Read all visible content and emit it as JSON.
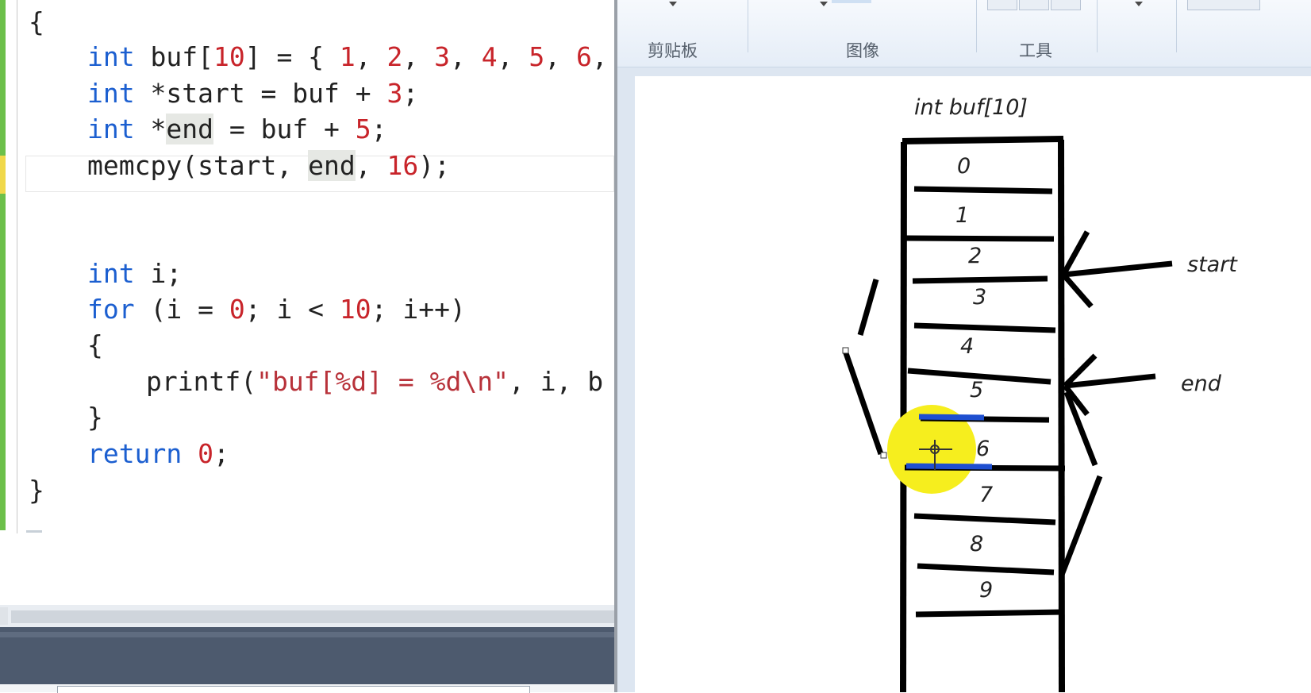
{
  "editor": {
    "lines": {
      "l1": {
        "brace": "{"
      },
      "l2": {
        "kw": "int",
        "a": " buf[",
        "n1": "10",
        "b": "] = { ",
        "v1": "1",
        "c1": ", ",
        "v2": "2",
        "c2": ", ",
        "v3": "3",
        "c3": ", ",
        "v4": "4",
        "c4": ", ",
        "v5": "5",
        "c5": ", ",
        "v6": "6",
        "c6": ","
      },
      "l3": {
        "kw": "int",
        "a": " *start = buf + ",
        "n": "3",
        "b": ";"
      },
      "l4": {
        "kw": "int",
        "a": " *",
        "ref": "end",
        "b": " = buf + ",
        "n": "5",
        "c": ";"
      },
      "l5": {
        "a": "memcpy(start, ",
        "ref": "end",
        "b": ", ",
        "n": "16",
        "c": ");"
      },
      "l6": {
        "kw": "int",
        "a": " i;"
      },
      "l7": {
        "kw": "for",
        "a": " (i = ",
        "n1": "0",
        "b": "; i < ",
        "n2": "10",
        "c": "; i++)"
      },
      "l8": {
        "brace": "{"
      },
      "l9": {
        "a": "printf(",
        "s": "\"buf[%d] = %d\\n\"",
        "b": ", i, b"
      },
      "l10": {
        "brace": "}"
      },
      "l11": {
        "kw": "return",
        "a": " ",
        "n": "0",
        "b": ";"
      },
      "l12": {
        "brace": "}"
      }
    }
  },
  "paint": {
    "ribbon": {
      "groups": [
        "剪贴板",
        "图像",
        "工具"
      ]
    },
    "drawing": {
      "title": "int buf[10]",
      "cells": [
        "0",
        "1",
        "2",
        "3",
        "4",
        "5",
        "6",
        "7",
        "8",
        "9"
      ],
      "start_label": "start",
      "end_label": "end"
    }
  }
}
